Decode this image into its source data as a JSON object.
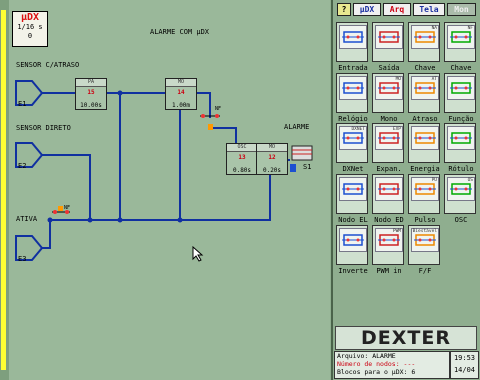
{
  "app": {
    "udx_title": "µDX",
    "udx_rate": "1/16 s",
    "udx_value": "0"
  },
  "canvas": {
    "title": "ALARME COM µDX",
    "labels": {
      "sensor_atraso": "SENSOR C/ATRASO",
      "sensor_direto": "SENSOR DIRETO",
      "ativa": "ATIVA",
      "alarme": "ALARME"
    },
    "inputs": [
      "E1",
      "E2",
      "E3"
    ],
    "output": "S1",
    "contacts": [
      "NF",
      "NF"
    ],
    "blocks": [
      {
        "id": "b15",
        "head": "PA",
        "num": "15",
        "value": "10.00s"
      },
      {
        "id": "b14",
        "head": "MO",
        "num": "14",
        "value": "1.00m"
      },
      {
        "id": "b13",
        "head": "OSC",
        "num": "13",
        "value": "0.80s"
      },
      {
        "id": "b12",
        "head": "MO",
        "num": "12",
        "value": "0.20s"
      }
    ]
  },
  "toolbar": {
    "help": "?",
    "udx": "µDX",
    "arq": "Arq",
    "tela": "Tela",
    "mon": "Mon"
  },
  "palette": [
    {
      "label": "Entrada",
      "icon": "input-icon"
    },
    {
      "label": "Saída",
      "icon": "output-icon"
    },
    {
      "label": "Chave",
      "icon": "switch-na-icon",
      "tag": "NA"
    },
    {
      "label": "Chave",
      "icon": "switch-nf-icon",
      "tag": "NF"
    },
    {
      "label": "Relógio",
      "icon": "clock-icon"
    },
    {
      "label": "Mono",
      "icon": "mono-icon",
      "tag": "MO"
    },
    {
      "label": "Atraso",
      "icon": "delay-icon",
      "tag": "AT"
    },
    {
      "label": "Função",
      "icon": "function-icon"
    },
    {
      "label": "DXNet",
      "icon": "dxnet-icon",
      "tag": "DXNET"
    },
    {
      "label": "Expan.",
      "icon": "expansion-icon",
      "tag": "EXP"
    },
    {
      "label": "Energia",
      "icon": "energy-icon"
    },
    {
      "label": "Rótulo",
      "icon": "label-icon"
    },
    {
      "label": "Nodo EL",
      "icon": "node-el-icon"
    },
    {
      "label": "Nodo ED",
      "icon": "node-ed-icon"
    },
    {
      "label": "Pulso",
      "icon": "pulse-icon",
      "tag": "PU"
    },
    {
      "label": "OSC",
      "icon": "osc-icon",
      "tag": "OS"
    },
    {
      "label": "Inverte",
      "icon": "invert-icon"
    },
    {
      "label": "PWM in",
      "icon": "pwm-icon",
      "tag": "PWM"
    },
    {
      "label": "F/F",
      "icon": "flipflop-icon",
      "tag": "Biestável"
    }
  ],
  "brand": "DEXTER",
  "info": {
    "arquivo_label": "Arquivo:",
    "arquivo": "ALARME",
    "nodos_label": "Número de nodos:",
    "nodos": "---",
    "blocos_label": "Blocos para o µDX:",
    "blocos": "6"
  },
  "clock": {
    "time": "19:53",
    "date": "14/04"
  }
}
